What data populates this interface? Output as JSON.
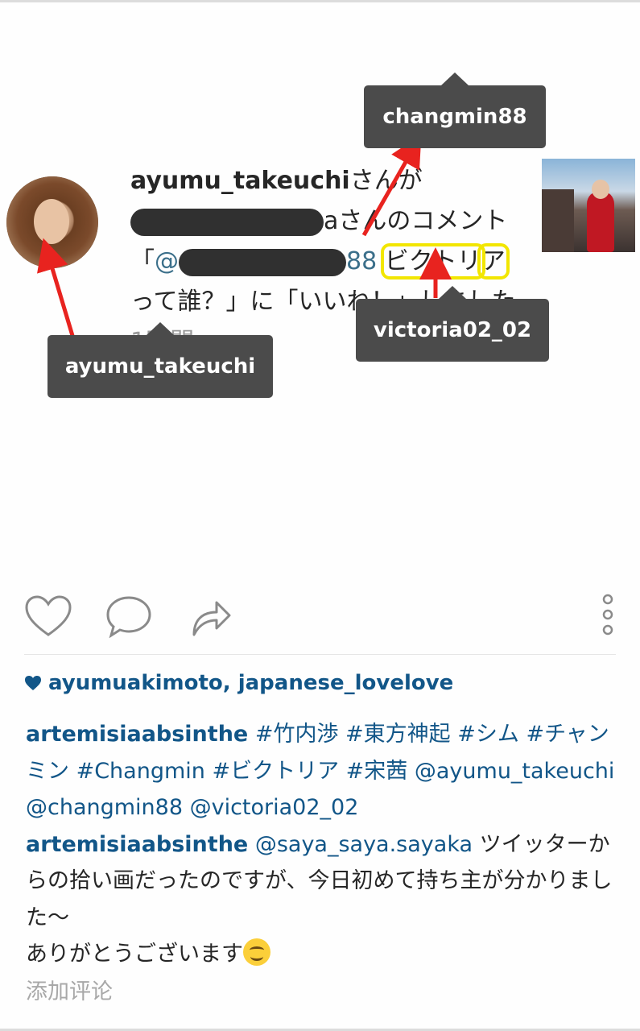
{
  "notification": {
    "username": "ayumu_takeuchi",
    "part1": "さんが",
    "redacted_suffix": "a",
    "part2": "さんのコメント「",
    "mention_prefix": "@",
    "mention_suffix": "88",
    "highlight1": "ビクトリ",
    "highlight2": "ア",
    "part3": "って誰？」に「いいね！」しました",
    "time": "1時間"
  },
  "callouts": {
    "top_right": "changmin88",
    "right": "victoria02_02",
    "left": "ayumu_takeuchi"
  },
  "actions": {
    "like_icon": "heart-icon",
    "comment_icon": "comment-bubble-icon",
    "share_icon": "share-arrow-icon",
    "more_icon": "more-vertical-icon"
  },
  "likes": {
    "icon": "heart-filled-icon",
    "text": "ayumuakimoto, japanese_lovelove"
  },
  "caption": {
    "user1": "artemisiaabsinthe",
    "tags1": "#竹内渉 #東方神起 #シム #チャンミン #Changmin #ビクトリア #宋茜 @ayumu_takeuchi @changmin88 @victoria02_02",
    "user2": "artemisiaabsinthe",
    "mention2": "@saya_saya.sayaka",
    "text2": "ツイッターからの拾い画だったのですが、今日初めて持ち主が分かりました〜",
    "text3": "ありがとうございます",
    "emoji": "smiling-face-emoji"
  },
  "add_comment": "添加评论",
  "colors": {
    "link": "#125688",
    "highlight": "#f2e600",
    "callout_bg": "#4b4b4b",
    "arrow": "#e8231f"
  }
}
